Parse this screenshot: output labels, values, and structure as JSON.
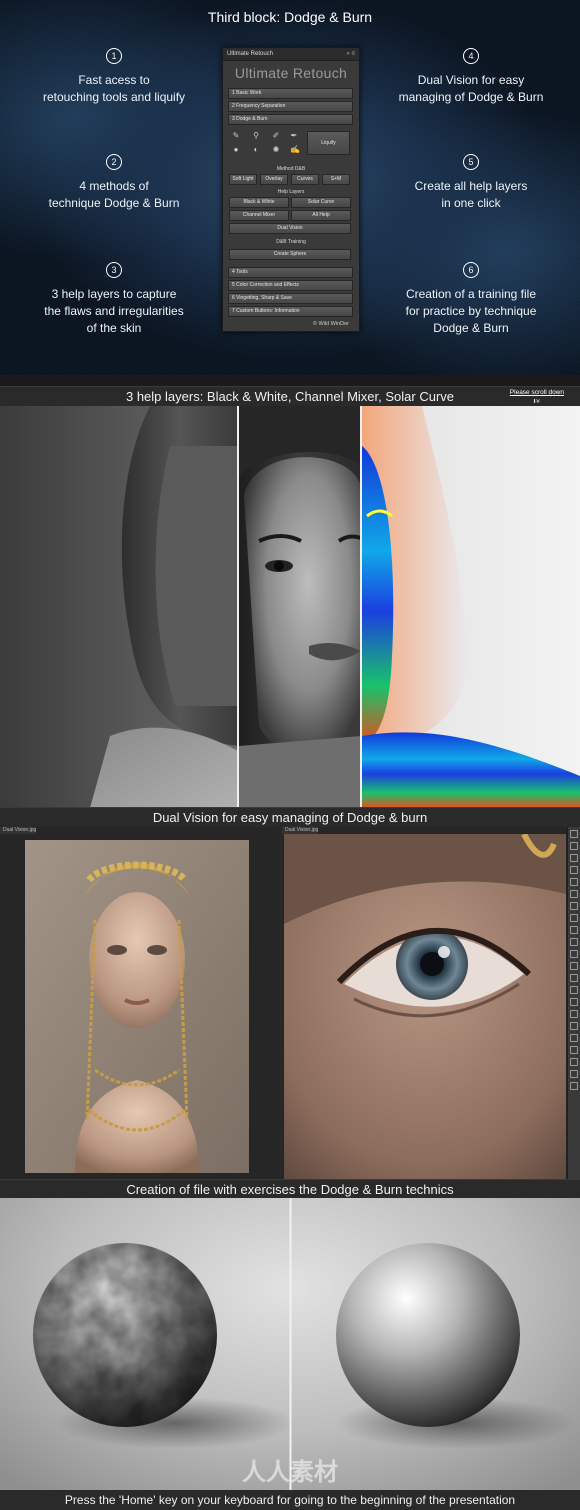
{
  "top": {
    "title": "Third block: Dodge & Burn",
    "features": [
      {
        "num": "1",
        "text": "Fast acess to\nretouching tools and liquify"
      },
      {
        "num": "2",
        "text": "4 methods of\ntechnique Dodge & Burn"
      },
      {
        "num": "3",
        "text": "3 help layers to capture\nthe flaws and irregularities\nof the skin"
      },
      {
        "num": "4",
        "text": "Dual Vision for easy\nmanaging of Dodge & Burn"
      },
      {
        "num": "5",
        "text": "Create all help layers\nin one click"
      },
      {
        "num": "6",
        "text": "Creation of a training file\nfor practice by technique\nDodge & Burn"
      }
    ]
  },
  "panel": {
    "window_title": "Ultimate Retouch",
    "window_controls": "» ≡",
    "title": "Ultimate Retouch",
    "sections": [
      "1 Basic Work",
      "2 Frequency Separation",
      "3 Dodge & Burn"
    ],
    "liquify": "Liquify",
    "method_label": "Method D&B",
    "methods": [
      "Soft Light",
      "Overlay",
      "Curves",
      "S+M"
    ],
    "help_layers_label": "Help Layers",
    "help_layers": [
      "Black & White",
      "Solar Curve",
      "Channel Mixer",
      "All Help"
    ],
    "dual_vision": "Dual Vision",
    "training_label": "D&B Training",
    "create_sphere": "Create Sphere",
    "bottom_sections": [
      "4 Tools",
      "5 Color Correction and Effects",
      "6 Vingetting, Sharp & Save",
      "7 Custom Buttons: Information"
    ],
    "footer": "© Wild WinDer"
  },
  "banner1": {
    "text": "3 help layers: Black & White, Channel Mixer, Solar Curve",
    "scroll": "Please scroll down",
    "scroll_arrow": "»"
  },
  "banner2": {
    "text": "Dual Vision for easy managing of Dodge & burn"
  },
  "dual": {
    "tab_left": "Dual Vision.jpg",
    "tab_right": "Dual Vision.jpg"
  },
  "banner3": {
    "text": "Creation of file with exercises the Dodge & Burn technics"
  },
  "footer": {
    "text": "Press the 'Home' key on your keyboard for going to the beginning of the presentation"
  },
  "watermark": "人人素材"
}
